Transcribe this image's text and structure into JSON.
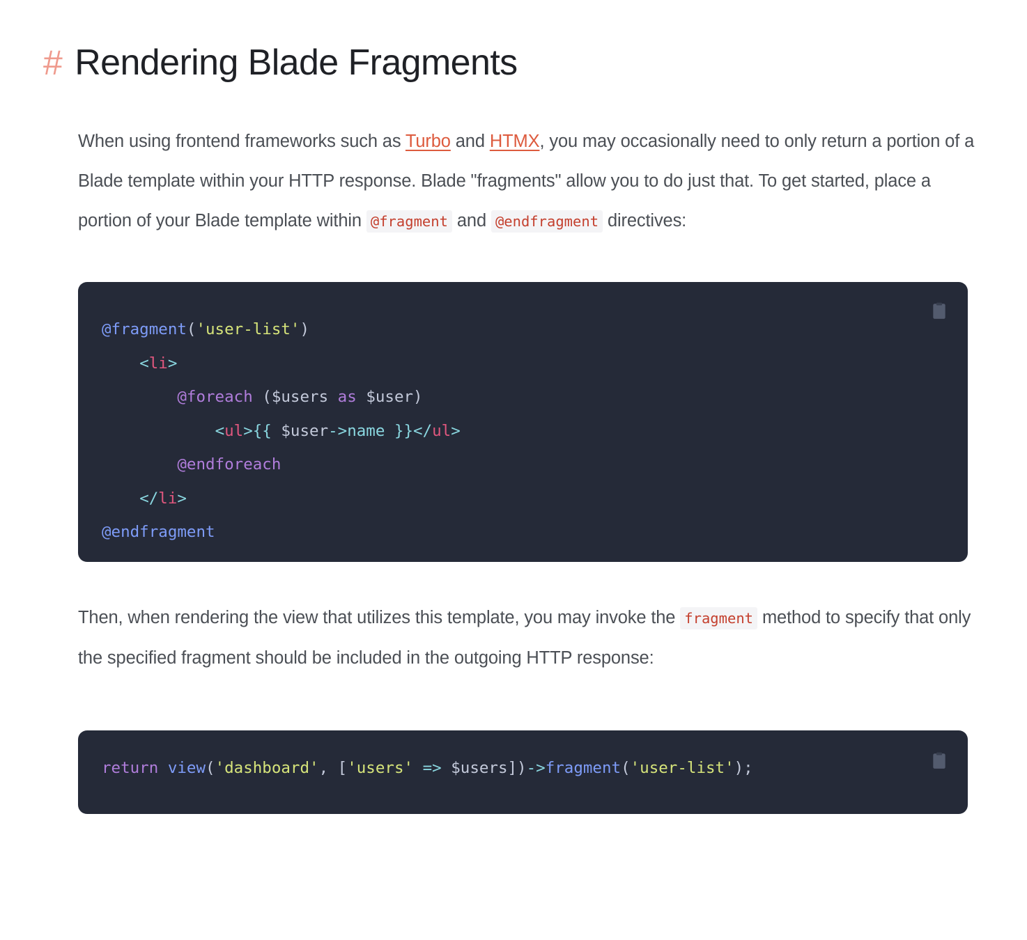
{
  "heading": {
    "hash": "#",
    "title": "Rendering Blade Fragments"
  },
  "paragraph_one": {
    "seg1": "When using frontend frameworks such as ",
    "link1": "Turbo",
    "seg2": " and ",
    "link2": "HTMX",
    "seg3": ", you may occasionally need to only return a portion of a Blade template within your HTTP response. Blade \"fragments\" allow you to do just that. To get started, place a portion of your Blade template within ",
    "code1": "@fragment",
    "seg4": " and ",
    "code2": "@endfragment",
    "seg5": " directives:"
  },
  "paragraph_two": {
    "seg1": "Then, when rendering the view that utilizes this template, you may invoke the ",
    "code1": "fragment",
    "seg2": " method to specify that only the specified fragment should be included in the outgoing HTTP response:"
  },
  "code_block_one": {
    "copy_icon": "clipboard-icon",
    "language": "blade",
    "lines": [
      [
        {
          "text": "@fragment",
          "cls": "t-directive"
        },
        {
          "text": "(",
          "cls": "t-plain"
        },
        {
          "text": "'user-list'",
          "cls": "t-string"
        },
        {
          "text": ")",
          "cls": "t-plain"
        }
      ],
      [
        {
          "text": "    ",
          "cls": "t-plain"
        },
        {
          "text": "<",
          "cls": "t-punct"
        },
        {
          "text": "li",
          "cls": "t-tag"
        },
        {
          "text": ">",
          "cls": "t-punct"
        }
      ],
      [
        {
          "text": "        ",
          "cls": "t-plain"
        },
        {
          "text": "@foreach",
          "cls": "t-keyword"
        },
        {
          "text": " (",
          "cls": "t-plain"
        },
        {
          "text": "$users",
          "cls": "t-var"
        },
        {
          "text": " ",
          "cls": "t-plain"
        },
        {
          "text": "as",
          "cls": "t-keyword"
        },
        {
          "text": " ",
          "cls": "t-plain"
        },
        {
          "text": "$user",
          "cls": "t-var"
        },
        {
          "text": ")",
          "cls": "t-plain"
        }
      ],
      [
        {
          "text": "            ",
          "cls": "t-plain"
        },
        {
          "text": "<",
          "cls": "t-punct"
        },
        {
          "text": "ul",
          "cls": "t-tag"
        },
        {
          "text": ">",
          "cls": "t-punct"
        },
        {
          "text": "{{",
          "cls": "t-punct"
        },
        {
          "text": " ",
          "cls": "t-plain"
        },
        {
          "text": "$user",
          "cls": "t-var"
        },
        {
          "text": "->",
          "cls": "t-punct"
        },
        {
          "text": "name",
          "cls": "t-prop"
        },
        {
          "text": " ",
          "cls": "t-plain"
        },
        {
          "text": "}}",
          "cls": "t-punct"
        },
        {
          "text": "</",
          "cls": "t-punct"
        },
        {
          "text": "ul",
          "cls": "t-tag"
        },
        {
          "text": ">",
          "cls": "t-punct"
        }
      ],
      [
        {
          "text": "        ",
          "cls": "t-plain"
        },
        {
          "text": "@endforeach",
          "cls": "t-keyword"
        }
      ],
      [
        {
          "text": "    ",
          "cls": "t-plain"
        },
        {
          "text": "</",
          "cls": "t-punct"
        },
        {
          "text": "li",
          "cls": "t-tag"
        },
        {
          "text": ">",
          "cls": "t-punct"
        }
      ],
      [
        {
          "text": "@endfragment",
          "cls": "t-directive"
        }
      ]
    ]
  },
  "code_block_two": {
    "copy_icon": "clipboard-icon",
    "language": "php",
    "lines": [
      [
        {
          "text": "return",
          "cls": "t-keyword"
        },
        {
          "text": " ",
          "cls": "t-plain"
        },
        {
          "text": "view",
          "cls": "t-directive"
        },
        {
          "text": "(",
          "cls": "t-plain"
        },
        {
          "text": "'dashboard'",
          "cls": "t-string"
        },
        {
          "text": ", [",
          "cls": "t-plain"
        },
        {
          "text": "'users'",
          "cls": "t-string"
        },
        {
          "text": " ",
          "cls": "t-plain"
        },
        {
          "text": "=>",
          "cls": "t-punct"
        },
        {
          "text": " ",
          "cls": "t-plain"
        },
        {
          "text": "$users",
          "cls": "t-var"
        },
        {
          "text": "])",
          "cls": "t-plain"
        },
        {
          "text": "->",
          "cls": "t-punct"
        },
        {
          "text": "fragment",
          "cls": "t-directive"
        },
        {
          "text": "(",
          "cls": "t-plain"
        },
        {
          "text": "'user-list'",
          "cls": "t-string"
        },
        {
          "text": ");",
          "cls": "t-plain"
        }
      ]
    ]
  },
  "colors": {
    "page_bg": "#ffffff",
    "heading_hash": "#ef9a8d",
    "heading_text": "#1f2126",
    "body_text": "#4b4f55",
    "link": "#dd5b3e",
    "inline_code_text": "#c4402e",
    "inline_code_bg": "#f4f4f6",
    "code_block_bg": "#252a38",
    "code_default": "#c9d0de"
  }
}
